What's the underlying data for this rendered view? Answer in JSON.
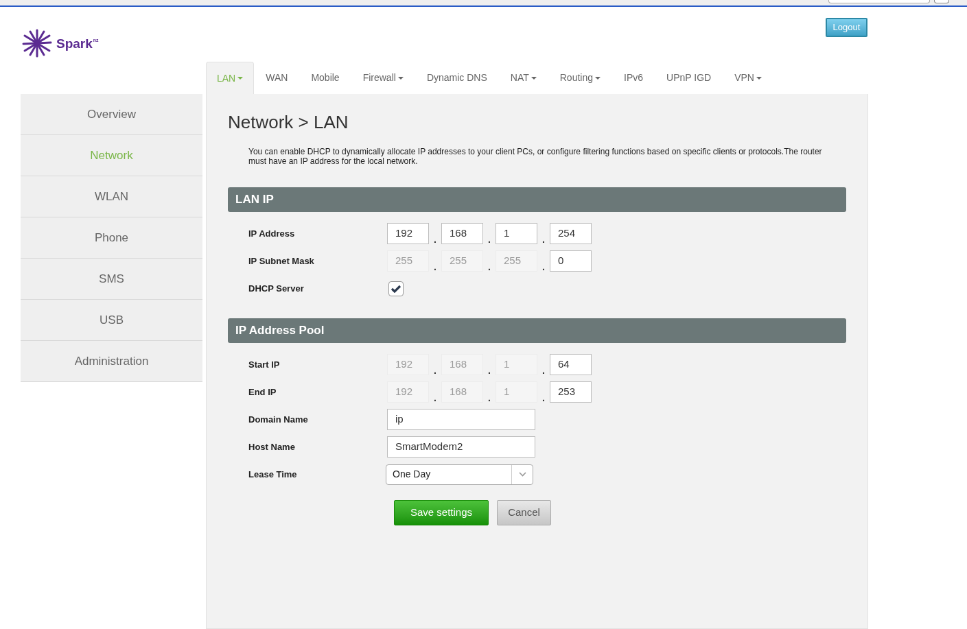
{
  "logo": {
    "text": "Spark",
    "sup": "nz"
  },
  "logout": "Logout",
  "tabs": [
    {
      "label": "LAN",
      "dropdown": true,
      "selected": true
    },
    {
      "label": "WAN",
      "dropdown": false,
      "selected": false
    },
    {
      "label": "Mobile",
      "dropdown": false,
      "selected": false
    },
    {
      "label": "Firewall",
      "dropdown": true,
      "selected": false
    },
    {
      "label": "Dynamic DNS",
      "dropdown": false,
      "selected": false
    },
    {
      "label": "NAT",
      "dropdown": true,
      "selected": false
    },
    {
      "label": "Routing",
      "dropdown": true,
      "selected": false
    },
    {
      "label": "IPv6",
      "dropdown": false,
      "selected": false
    },
    {
      "label": "UPnP IGD",
      "dropdown": false,
      "selected": false
    },
    {
      "label": "VPN",
      "dropdown": true,
      "selected": false
    }
  ],
  "sidebar": {
    "items": [
      {
        "label": "Overview",
        "selected": false
      },
      {
        "label": "Network",
        "selected": true
      },
      {
        "label": "WLAN",
        "selected": false
      },
      {
        "label": "Phone",
        "selected": false
      },
      {
        "label": "SMS",
        "selected": false
      },
      {
        "label": "USB",
        "selected": false
      },
      {
        "label": "Administration",
        "selected": false
      }
    ]
  },
  "page": {
    "title": "Network > LAN",
    "description": "You can enable DHCP to dynamically allocate IP addresses to your client PCs, or configure filtering functions based on specific clients or protocols.The router must have an IP address for the local network."
  },
  "sections": [
    {
      "title": "LAN IP",
      "rows": [
        {
          "kind": "ip",
          "label": "IP Address",
          "separators": [
            ".",
            ".",
            "."
          ],
          "octets": [
            {
              "value": "192",
              "disabled": false
            },
            {
              "value": "168",
              "disabled": false
            },
            {
              "value": "1",
              "disabled": false
            },
            {
              "value": "254",
              "disabled": false
            }
          ]
        },
        {
          "kind": "ip",
          "label": "IP Subnet Mask",
          "separators": [
            ".",
            ".",
            "."
          ],
          "octets": [
            {
              "value": "255",
              "disabled": true
            },
            {
              "value": "255",
              "disabled": true
            },
            {
              "value": "255",
              "disabled": true
            },
            {
              "value": "0",
              "disabled": false
            }
          ]
        },
        {
          "kind": "checkbox",
          "label": "DHCP Server",
          "checked": true
        }
      ]
    },
    {
      "title": "IP Address Pool",
      "rows": [
        {
          "kind": "ip",
          "label": "Start IP",
          "separators": [
            ".",
            ".",
            "."
          ],
          "octets": [
            {
              "value": "192",
              "disabled": true
            },
            {
              "value": "168",
              "disabled": true
            },
            {
              "value": "1",
              "disabled": true
            },
            {
              "value": "64",
              "disabled": false
            }
          ]
        },
        {
          "kind": "ip",
          "label": "End IP",
          "separators": [
            ".",
            ".",
            "."
          ],
          "octets": [
            {
              "value": "192",
              "disabled": true
            },
            {
              "value": "168",
              "disabled": true
            },
            {
              "value": "1",
              "disabled": true
            },
            {
              "value": "253",
              "disabled": false
            }
          ]
        },
        {
          "kind": "text",
          "label": "Domain Name",
          "value": "ip"
        },
        {
          "kind": "text",
          "label": "Host Name",
          "value": "SmartModem2"
        },
        {
          "kind": "select",
          "label": "Lease Time",
          "value": "One Day"
        }
      ]
    }
  ],
  "buttons": {
    "save": "Save settings",
    "cancel": "Cancel"
  }
}
